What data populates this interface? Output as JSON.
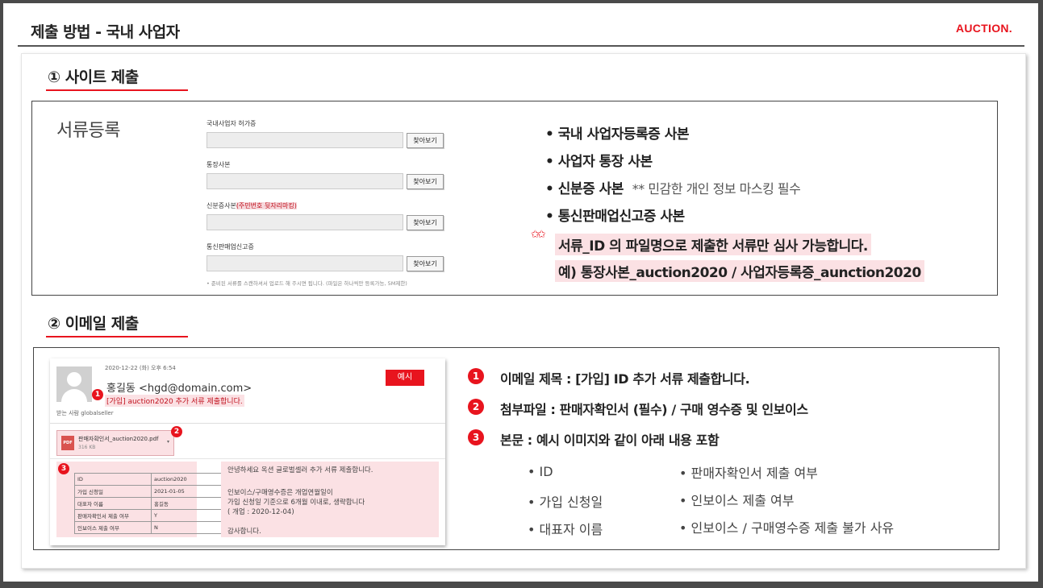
{
  "header": {
    "title": "제출 방법 - 국내 사업자",
    "logo": "AUCTION."
  },
  "section1": {
    "heading": "① 사이트 제출",
    "doc_label": "서류등록",
    "fields": [
      {
        "label": "국내사업자 허가증",
        "button": "찾아보기"
      },
      {
        "label": "통장사본",
        "button": "찾아보기"
      },
      {
        "label_prefix": "신분증사본",
        "label_highlight": "(주민번호 뒷자리마킹)",
        "button": "찾아보기"
      },
      {
        "label": "통신판매업신고증",
        "button": "찾아보기"
      }
    ],
    "note": "• 준비된 서류를 스캔하셔서 업로드 해 주시면 됩니다. (파일은 하나씩만 등록가능, 5M제한)",
    "bullets": [
      {
        "text": "• 국내 사업자등록증 사본"
      },
      {
        "text": "• 사업자 통장 사본"
      },
      {
        "text": "• 신분증 사본",
        "extra": "** 민감한 개인 정보 마스킹 필수"
      },
      {
        "text": "• 통신판매업신고증 사본"
      }
    ],
    "stars": "✩✩",
    "highlight_line1": "서류_ID 의 파일명으로 제출한 서류만 심사 가능합니다.",
    "highlight_line2": "예) 통장사본_auction2020 /  사업자등록증_aunction2020"
  },
  "section2": {
    "heading": "② 이메일 제출",
    "email": {
      "date": "2020-12-22 (화) 오후 6:54",
      "from": "홍길동 <hgd@domain.com>",
      "subject": "[가입] auction2020 추가 서류 제출합니다.",
      "to": "받는 사람  globalseller",
      "badge": "예시",
      "attachment_name": "판매자확인서_auction2020.pdf",
      "attachment_size": "316 KB",
      "attachment_type": "PDF",
      "table": [
        {
          "k": "ID",
          "v": "auction2020"
        },
        {
          "k": "가입 신청일",
          "v": "2021-01-05"
        },
        {
          "k": "대표자 이름",
          "v": "홍길동"
        },
        {
          "k": "판매자확인서 제출 여부",
          "v": "Y"
        },
        {
          "k": "인보이스 제출 여부",
          "v": "N"
        }
      ],
      "body": {
        "greeting": "안녕하세요 옥션 글로벌셀러 추가 서류 제출합니다.",
        "line1": "인보이스/구매영수증은 개업연월일이",
        "line2": "가입 신청일 기준으로 6개월 이내로, 생략합니다",
        "line3": "( 개업 : 2020-12-04)",
        "closing": "감사합니다."
      },
      "markers": [
        "1",
        "2",
        "3"
      ]
    },
    "items": [
      {
        "num": "1",
        "text": "이메일 제목 : [가입] ID 추가 서류 제출합니다."
      },
      {
        "num": "2",
        "text": "첨부파일 : 판매자확인서 (필수) / 구매 영수증 및 인보이스"
      },
      {
        "num": "3",
        "text": "본문 : 예시 이미지와 같이 아래 내용 포함"
      }
    ],
    "content_left": [
      "• ID",
      "• 가입 신청일",
      "• 대표자 이름"
    ],
    "content_right": [
      "• 판매자확인서 제출 여부",
      "• 인보이스 제출 여부",
      "• 인보이스 / 구매영수증 제출 불가 사유"
    ]
  }
}
